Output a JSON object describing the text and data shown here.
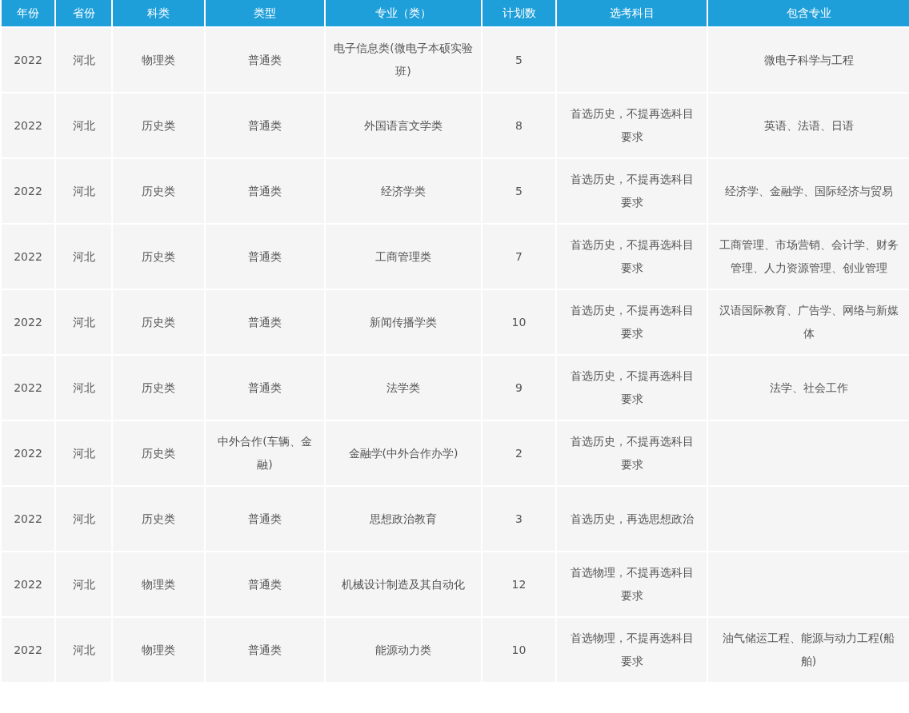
{
  "table": {
    "columns": [
      "年份",
      "省份",
      "科类",
      "类型",
      "专业（类）",
      "计划数",
      "选考科目",
      "包含专业"
    ],
    "rows": [
      [
        "2022",
        "河北",
        "物理类",
        "普通类",
        "电子信息类(微电子本硕实验班)",
        "5",
        null,
        "微电子科学与工程"
      ],
      [
        "2022",
        "河北",
        "历史类",
        "普通类",
        "外国语言文学类",
        "8",
        "首选历史，不提再选科目要求",
        "英语、法语、日语"
      ],
      [
        "2022",
        "河北",
        "历史类",
        "普通类",
        "经济学类",
        "5",
        "首选历史，不提再选科目要求",
        "经济学、金融学、国际经济与贸易"
      ],
      [
        "2022",
        "河北",
        "历史类",
        "普通类",
        "工商管理类",
        "7",
        "首选历史，不提再选科目要求",
        "工商管理、市场营销、会计学、财务管理、人力资源管理、创业管理"
      ],
      [
        "2022",
        "河北",
        "历史类",
        "普通类",
        "新闻传播学类",
        "10",
        "首选历史，不提再选科目要求",
        "汉语国际教育、广告学、网络与新媒体"
      ],
      [
        "2022",
        "河北",
        "历史类",
        "普通类",
        "法学类",
        "9",
        "首选历史，不提再选科目要求",
        "法学、社会工作"
      ],
      [
        "2022",
        "河北",
        "历史类",
        "中外合作(车辆、金融)",
        "金融学(中外合作办学)",
        "2",
        "首选历史，不提再选科目要求",
        null
      ],
      [
        "2022",
        "河北",
        "历史类",
        "普通类",
        "思想政治教育",
        "3",
        "首选历史，再选思想政治",
        null
      ],
      [
        "2022",
        "河北",
        "物理类",
        "普通类",
        "机械设计制造及其自动化",
        "12",
        "首选物理，不提再选科目要求",
        null
      ],
      [
        "2022",
        "河北",
        "物理类",
        "普通类",
        "能源动力类",
        "10",
        "首选物理，不提再选科目要求",
        "油气储运工程、能源与动力工程(船舶)"
      ]
    ]
  }
}
